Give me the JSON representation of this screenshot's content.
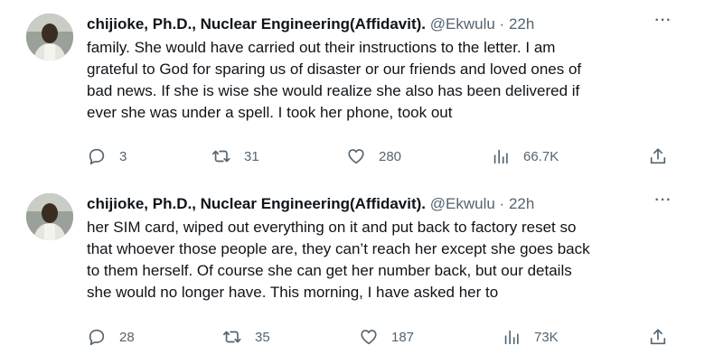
{
  "tweets": [
    {
      "author_name": "chijioke, Ph.D., Nuclear Engineering(Affidavit).",
      "handle": "@Ekwulu",
      "separator": "·",
      "time": "22h",
      "more_label": "···",
      "lines": [
        "family. She would have carried out their instructions to the letter. I am",
        "grateful to God for sparing us of disaster or our friends and loved ones of",
        "bad news. If she is wise she would realize she also has been delivered if",
        "ever she was under a spell. I took her phone, took out"
      ],
      "replies": "3",
      "reposts": "31",
      "likes": "280",
      "views": "66.7K"
    },
    {
      "author_name": "chijioke, Ph.D., Nuclear Engineering(Affidavit).",
      "handle": "@Ekwulu",
      "separator": "·",
      "time": "22h",
      "more_label": "···",
      "lines": [
        "her SIM card, wiped out everything on it and put back to factory reset so",
        "that whoever those people are, they can’t reach her except she goes back",
        "to them herself. Of course she can get her number back, but our details",
        "she would no longer have. This morning, I have asked her to"
      ],
      "replies": "28",
      "reposts": "35",
      "likes": "187",
      "views": "73K"
    }
  ],
  "icons": {
    "reply": "reply-icon",
    "repost": "repost-icon",
    "like": "heart-icon",
    "views": "views-chart-icon",
    "share": "share-icon"
  },
  "colors": {
    "text": "#0f1419",
    "secondary": "#536471",
    "divider": "#eff3f4"
  }
}
